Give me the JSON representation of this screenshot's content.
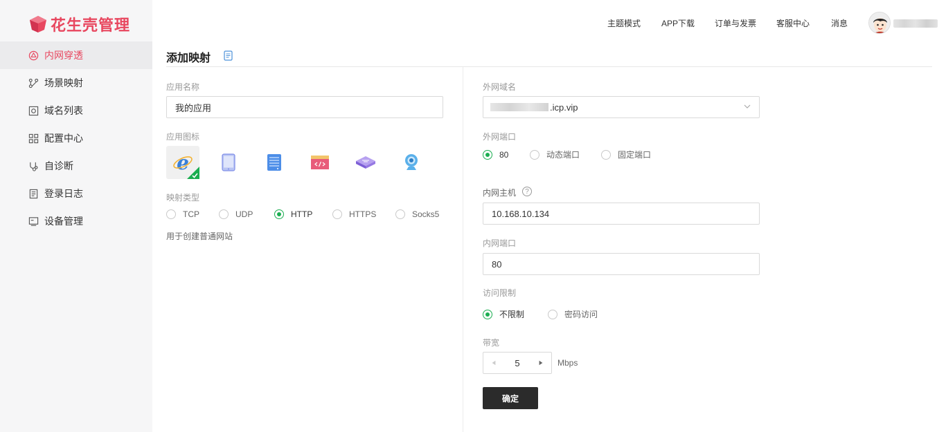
{
  "brand": {
    "name": "花生壳管理",
    "color": "#e8475f"
  },
  "sidebar": {
    "items": [
      {
        "label": "内网穿透",
        "icon": "network-penetration-icon",
        "active": true
      },
      {
        "label": "场景映射",
        "icon": "scene-mapping-icon"
      },
      {
        "label": "域名列表",
        "icon": "domain-list-icon"
      },
      {
        "label": "配置中心",
        "icon": "config-center-icon"
      },
      {
        "label": "自诊断",
        "icon": "self-diagnosis-icon"
      },
      {
        "label": "登录日志",
        "icon": "login-log-icon"
      },
      {
        "label": "设备管理",
        "icon": "device-management-icon"
      }
    ]
  },
  "header": {
    "links": [
      "主题模式",
      "APP下载",
      "订单与发票",
      "客服中心",
      "消息"
    ]
  },
  "page": {
    "title": "添加映射"
  },
  "form": {
    "app_name_label": "应用名称",
    "app_name_value": "我的应用",
    "app_icon_label": "应用图标",
    "mapping_type_label": "映射类型",
    "mapping_types": [
      "TCP",
      "UDP",
      "HTTP",
      "HTTPS",
      "Socks5"
    ],
    "mapping_type_selected": "HTTP",
    "mapping_hint": "用于创建普通网站",
    "ext_domain_label": "外网域名",
    "ext_domain_suffix": ".icp.vip",
    "ext_port_label": "外网端口",
    "ext_port_options": [
      "80",
      "动态端口",
      "固定端口"
    ],
    "ext_port_selected": "80",
    "int_host_label": "内网主机",
    "int_host_help": "?",
    "int_host_value": "10.168.10.134",
    "int_port_label": "内网端口",
    "int_port_value": "80",
    "access_label": "访问限制",
    "access_options": [
      "不限制",
      "密码访问"
    ],
    "access_selected": "不限制",
    "bandwidth_label": "带宽",
    "bandwidth_value": "5",
    "bandwidth_unit": "Mbps",
    "submit_label": "确定"
  },
  "colors": {
    "accent_green": "#1aad50",
    "button_dark": "#2b2b2b"
  }
}
